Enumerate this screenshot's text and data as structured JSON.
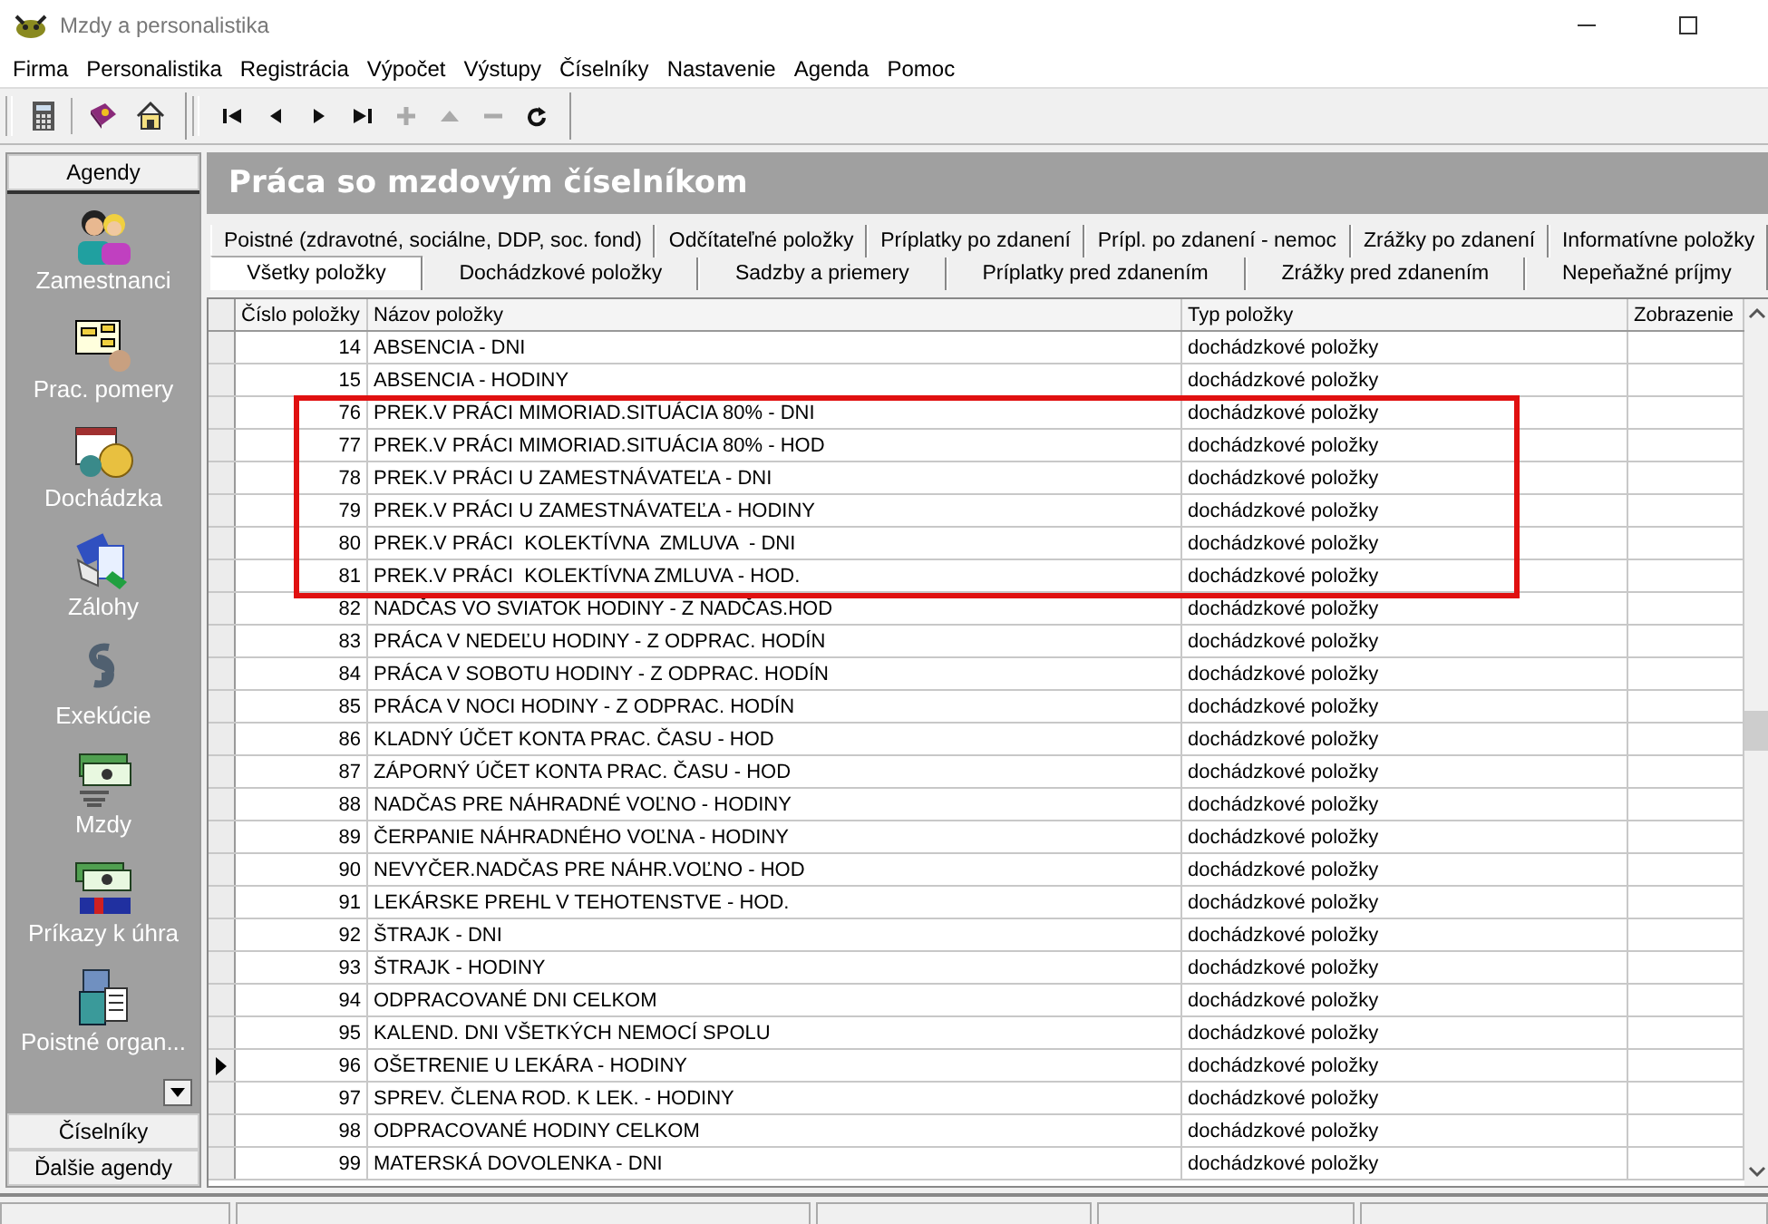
{
  "window": {
    "title": "Mzdy a personalistika"
  },
  "menu": [
    "Firma",
    "Personalistika",
    "Registrácia",
    "Výpočet",
    "Výstupy",
    "Číselníky",
    "Nastavenie",
    "Agenda",
    "Pomoc"
  ],
  "toolbar": [
    {
      "kind": "calculator"
    },
    {
      "kind": "book"
    },
    {
      "kind": "home"
    }
  ],
  "navigator": [
    {
      "kind": "first",
      "disabled": false
    },
    {
      "kind": "prev",
      "disabled": false
    },
    {
      "kind": "next",
      "disabled": false
    },
    {
      "kind": "last",
      "disabled": false
    },
    {
      "kind": "add",
      "disabled": true
    },
    {
      "kind": "edit",
      "disabled": true
    },
    {
      "kind": "delete",
      "disabled": true
    },
    {
      "kind": "refresh",
      "disabled": false
    }
  ],
  "sidebar": {
    "header": "Agendy",
    "items": [
      {
        "label": "Zamestnanci",
        "kind": "people"
      },
      {
        "label": "Prac. pomery",
        "kind": "chart"
      },
      {
        "label": "Dochádzka",
        "kind": "calendar"
      },
      {
        "label": "Zálohy",
        "kind": "money-hand"
      },
      {
        "label": "Exekúcie",
        "kind": "paragraph"
      },
      {
        "label": "Mzdy",
        "kind": "cash"
      },
      {
        "label": "Príkazy k úhra",
        "kind": "sepa"
      },
      {
        "label": "Poistné organ...",
        "kind": "building"
      }
    ],
    "footer": [
      "Číselníky",
      "Ďalšie agendy"
    ]
  },
  "panel_title": "Práca so mzdovým číselníkom",
  "tab_rows": [
    [
      {
        "label": "Poistné (zdravotné, sociálne, DDP, soc. fond)",
        "selected": false
      },
      {
        "label": "Odčítateľné položky",
        "selected": false
      },
      {
        "label": "Príplatky po zdanení",
        "selected": false
      },
      {
        "label": "Prípl. po zdanení - nemoc",
        "selected": false
      },
      {
        "label": "Zrážky po zdanení",
        "selected": false
      },
      {
        "label": "Informatívne položky",
        "selected": false
      }
    ],
    [
      {
        "label": "Všetky položky",
        "selected": true
      },
      {
        "label": "Dochádzkové položky",
        "selected": false
      },
      {
        "label": "Sadzby a priemery",
        "selected": false
      },
      {
        "label": "Príplatky pred zdanením",
        "selected": false
      },
      {
        "label": "Zrážky pred zdanením",
        "selected": false
      },
      {
        "label": "Nepeňažné príjmy",
        "selected": false
      }
    ]
  ],
  "table": {
    "columns": [
      "Číslo položky",
      "Názov položky",
      "Typ položky",
      "Zobrazenie"
    ],
    "rows": [
      {
        "number": "14",
        "name": "ABSENCIA - DNI",
        "type": "dochádzkové položky",
        "selected": false,
        "highlighted": false
      },
      {
        "number": "15",
        "name": "ABSENCIA - HODINY",
        "type": "dochádzkové položky",
        "selected": false,
        "highlighted": false
      },
      {
        "number": "76",
        "name": "PREK.V PRÁCI MIMORIAD.SITUÁCIA 80% - DNI",
        "type": "dochádzkové položky",
        "selected": false,
        "highlighted": true
      },
      {
        "number": "77",
        "name": "PREK.V PRÁCI MIMORIAD.SITUÁCIA 80% - HOD",
        "type": "dochádzkové položky",
        "selected": false,
        "highlighted": true
      },
      {
        "number": "78",
        "name": "PREK.V PRÁCI U ZAMESTNÁVATEĽA - DNI",
        "type": "dochádzkové položky",
        "selected": false,
        "highlighted": true
      },
      {
        "number": "79",
        "name": "PREK.V PRÁCI U ZAMESTNÁVATEĽA - HODINY",
        "type": "dochádzkové položky",
        "selected": false,
        "highlighted": true
      },
      {
        "number": "80",
        "name": "PREK.V PRÁCI  KOLEKTÍVNA  ZMLUVA  - DNI",
        "type": "dochádzkové položky",
        "selected": false,
        "highlighted": true
      },
      {
        "number": "81",
        "name": "PREK.V PRÁCI  KOLEKTÍVNA ZMLUVA - HOD.",
        "type": "dochádzkové položky",
        "selected": false,
        "highlighted": true
      },
      {
        "number": "82",
        "name": "NADČAS VO SVIATOK HODINY - Z NADČAS.HOD",
        "type": "dochádzkové položky",
        "selected": false,
        "highlighted": false
      },
      {
        "number": "83",
        "name": "PRÁCA V NEDEĽU HODINY - Z ODPRAC. HODÍN",
        "type": "dochádzkové položky",
        "selected": false,
        "highlighted": false
      },
      {
        "number": "84",
        "name": "PRÁCA V SOBOTU HODINY - Z ODPRAC. HODÍN",
        "type": "dochádzkové položky",
        "selected": false,
        "highlighted": false
      },
      {
        "number": "85",
        "name": "PRÁCA V NOCI HODINY - Z ODPRAC. HODÍN",
        "type": "dochádzkové položky",
        "selected": false,
        "highlighted": false
      },
      {
        "number": "86",
        "name": "KLADNÝ ÚČET KONTA PRAC. ČASU - HOD",
        "type": "dochádzkové položky",
        "selected": false,
        "highlighted": false
      },
      {
        "number": "87",
        "name": "ZÁPORNÝ ÚČET KONTA PRAC. ČASU - HOD",
        "type": "dochádzkové položky",
        "selected": false,
        "highlighted": false
      },
      {
        "number": "88",
        "name": "NADČAS PRE NÁHRADNÉ VOĽNO - HODINY",
        "type": "dochádzkové položky",
        "selected": false,
        "highlighted": false
      },
      {
        "number": "89",
        "name": "ČERPANIE NÁHRADNÉHO VOĽNA - HODINY",
        "type": "dochádzkové položky",
        "selected": false,
        "highlighted": false
      },
      {
        "number": "90",
        "name": "NEVYČER.NADČAS PRE NÁHR.VOĽNO - HOD",
        "type": "dochádzkové položky",
        "selected": false,
        "highlighted": false
      },
      {
        "number": "91",
        "name": "LEKÁRSKE PREHL V TEHOTENSTVE - HOD.",
        "type": "dochádzkové položky",
        "selected": false,
        "highlighted": false
      },
      {
        "number": "92",
        "name": "ŠTRAJK - DNI",
        "type": "dochádzkové položky",
        "selected": false,
        "highlighted": false
      },
      {
        "number": "93",
        "name": "ŠTRAJK - HODINY",
        "type": "dochádzkové položky",
        "selected": false,
        "highlighted": false
      },
      {
        "number": "94",
        "name": "ODPRACOVANÉ DNI CELKOM",
        "type": "dochádzkové položky",
        "selected": false,
        "highlighted": false
      },
      {
        "number": "95",
        "name": "KALEND. DNI VŠETKÝCH NEMOCÍ SPOLU",
        "type": "dochádzkové položky",
        "selected": false,
        "highlighted": false
      },
      {
        "number": "96",
        "name": "OŠETRENIE U LEKÁRA - HODINY",
        "type": "dochádzkové položky",
        "selected": true,
        "highlighted": false
      },
      {
        "number": "97",
        "name": "SPREV. ČLENA ROD. K LEK. - HODINY",
        "type": "dochádzkové položky",
        "selected": false,
        "highlighted": false
      },
      {
        "number": "98",
        "name": "ODPRACOVANÉ HODINY CELKOM",
        "type": "dochádzkové položky",
        "selected": false,
        "highlighted": false
      },
      {
        "number": "99",
        "name": "MATERSKÁ DOVOLENKA - DNI",
        "type": "dochádzkové položky",
        "selected": false,
        "highlighted": false
      }
    ]
  }
}
